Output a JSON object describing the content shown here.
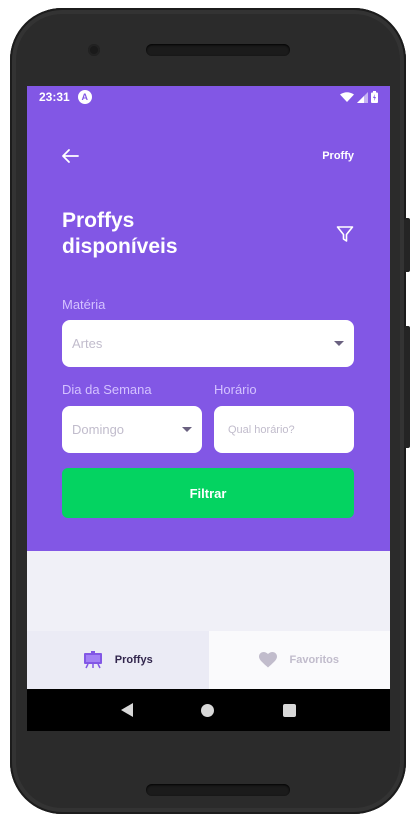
{
  "status_bar": {
    "time": "23:31",
    "app_indicator": "A"
  },
  "header": {
    "brand": "Proffy",
    "title_line1": "Proffys",
    "title_line2": "disponíveis"
  },
  "form": {
    "materia_label": "Matéria",
    "materia_value": "Artes",
    "dia_label": "Dia da Semana",
    "dia_value": "Domingo",
    "horario_label": "Horário",
    "horario_placeholder": "Qual horário?",
    "filter_button": "Filtrar"
  },
  "tabs": [
    {
      "label": "Proffys",
      "icon": "easel-icon",
      "active": true
    },
    {
      "label": "Favoritos",
      "icon": "heart-icon",
      "active": false
    }
  ],
  "colors": {
    "primary": "#8257e5",
    "success": "#04d361",
    "background": "#f0f0f7"
  }
}
